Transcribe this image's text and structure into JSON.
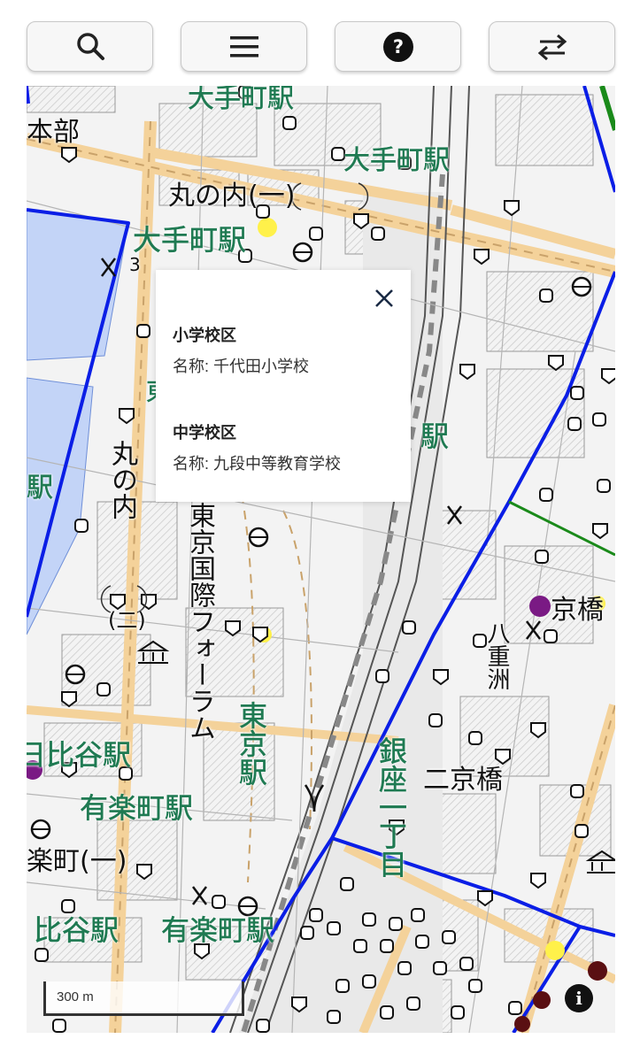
{
  "toolbar": {
    "buttons": [
      {
        "icon": "search-icon"
      },
      {
        "icon": "menu-icon"
      },
      {
        "icon": "help-icon"
      },
      {
        "icon": "swap-icon"
      }
    ]
  },
  "map": {
    "labels": {
      "otemachi_station_top": "大手町駅",
      "otemachi_station_mid": "大手町駅",
      "otemachi_station_left": "大手町駅",
      "honbu": "本部",
      "marunouchi_1": "丸の内(一)",
      "marunouchi_2": "丸の内",
      "marunouchi_2_num": "(二)",
      "tokyo_intl_forum": "東京国際フォーラム",
      "tokyo_station_mid": "駅",
      "tokyo_station_vert": "東京駅",
      "hibiya_station_mid": "日比谷駅",
      "yurakucho_station_mid": "有楽町駅",
      "yurakucho_1": "楽町(一)",
      "hibiya_station_bottom": "比谷駅",
      "yurakucho_station_bottom": "有楽町駅",
      "kyobashi_1": "京橋",
      "kyobashi_2": "二京橋",
      "yaesu": "八重洲",
      "ginza": "銀座一丁目",
      "left_station_fragment": "駅",
      "number_3": "3",
      "east_fragment": "東"
    },
    "colors": {
      "district_boundary": "#0a1ee6",
      "junior_high_boundary": "#1a8a1a",
      "road": "#f4d29a",
      "water": "#c3d4f7",
      "station_label": "#1f7a52"
    }
  },
  "popup": {
    "close_label": "×",
    "elementary_heading": "小学校区",
    "elementary_name": "名称: 千代田小学校",
    "junior_heading": "中学校区",
    "junior_name": "名称: 九段中等教育学校"
  },
  "scale_bar": {
    "label": "300 m"
  },
  "info_button": {
    "label": "i"
  }
}
